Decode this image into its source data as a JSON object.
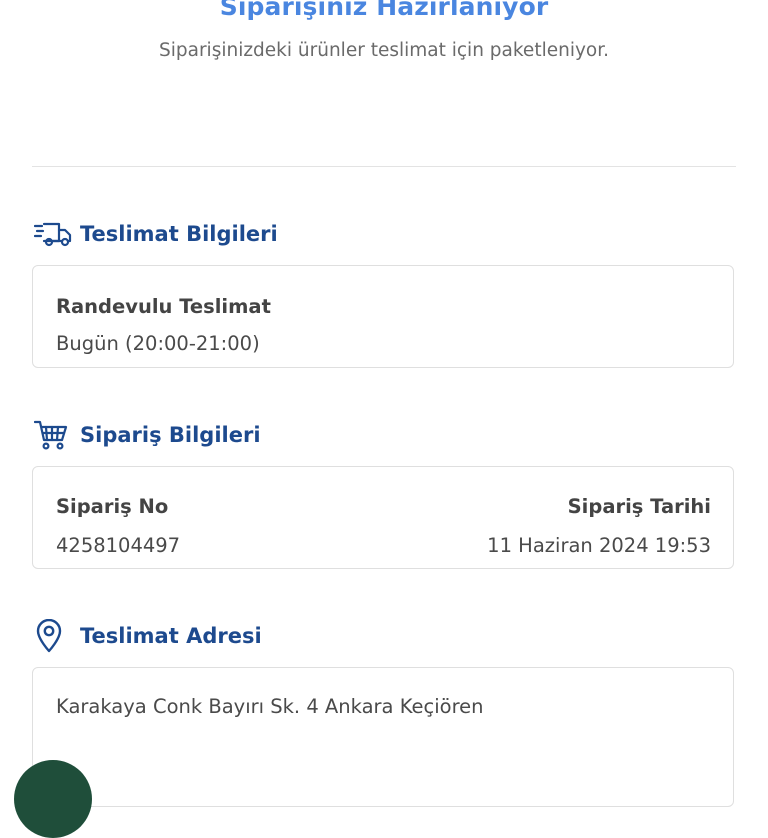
{
  "header": {
    "title": "Siparişiniz Hazırlanıyor",
    "subtitle": "Siparişinizdeki ürünler teslimat için paketleniyor."
  },
  "delivery": {
    "section_icon": "delivery-truck-icon",
    "section_title": "Teslimat Bilgileri",
    "type_label": "Randevulu Teslimat",
    "time_value": "Bugün (20:00-21:00)"
  },
  "order": {
    "section_icon": "shopping-cart-icon",
    "section_title": "Sipariş Bilgileri",
    "number_label": "Sipariş No",
    "number_value": "4258104497",
    "date_label": "Sipariş Tarihi",
    "date_value": "11 Haziran 2024 19:53"
  },
  "address": {
    "section_icon": "location-pin-icon",
    "section_title": "Teslimat Adresi",
    "value": "Karakaya Conk Bayırı Sk. 4 Ankara Keçiören"
  },
  "colors": {
    "title_blue": "#4a86e0",
    "section_blue": "#1d4a8e",
    "fab_green": "#1f4e3a"
  }
}
